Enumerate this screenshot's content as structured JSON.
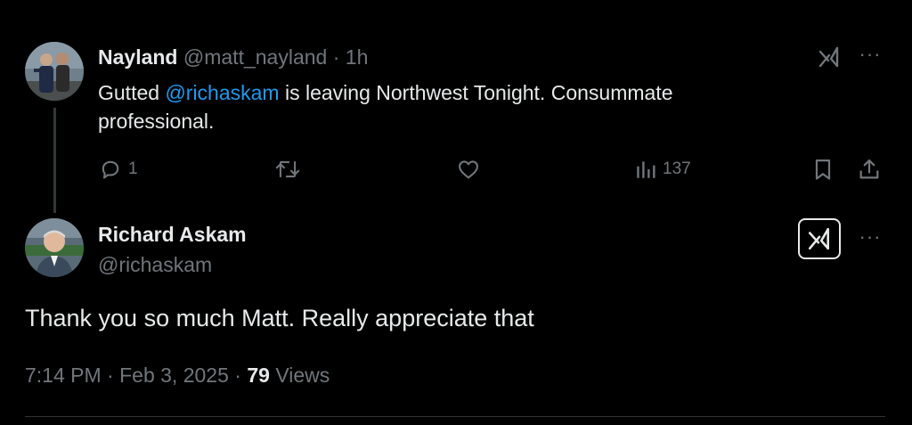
{
  "parent_tweet": {
    "display_name": "Nayland",
    "handle": "@matt_nayland",
    "separator": "·",
    "time_ago": "1h",
    "text_before_mention": "Gutted ",
    "mention": "@richaskam",
    "text_after_mention": " is leaving Northwest Tonight. Consummate professional.",
    "replies": "1",
    "views": "137",
    "more_label": "···"
  },
  "reply_tweet": {
    "display_name": "Richard Askam",
    "handle": "@richaskam",
    "text": "Thank you so much Matt. Really appreciate that",
    "time": "7:14 PM",
    "date": "Feb 3, 2025",
    "separator": "·",
    "views_count": "79",
    "views_label": "Views",
    "more_label": "···"
  },
  "icons": {
    "reply": "reply-icon",
    "repost": "repost-icon",
    "like": "like-icon",
    "analytics": "analytics-icon",
    "bookmark": "bookmark-icon",
    "share": "share-icon",
    "grok": "grok-icon",
    "more": "more-icon"
  },
  "colors": {
    "background": "#000000",
    "text": "#e7e9ea",
    "muted": "#71767b",
    "mention": "#1d9bf0",
    "divider": "#2f3336"
  }
}
